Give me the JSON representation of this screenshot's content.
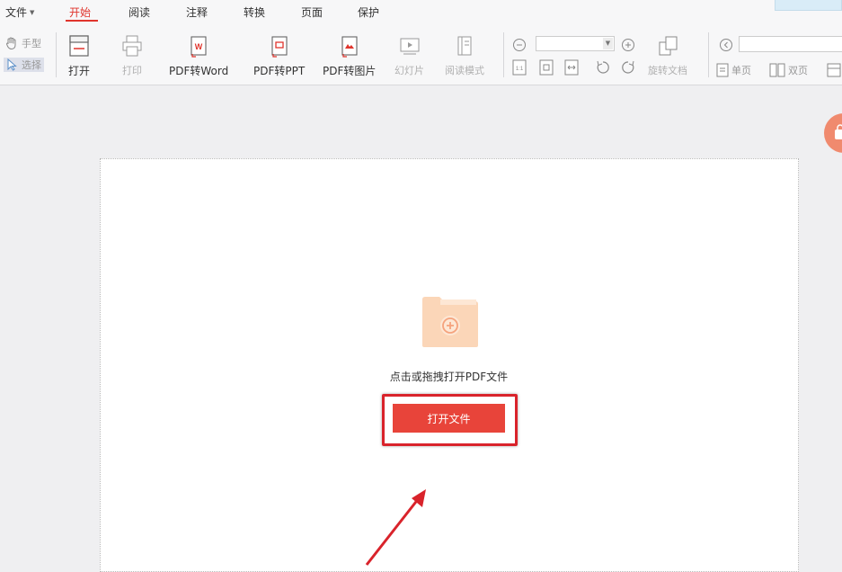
{
  "menu": {
    "file": "文件",
    "tabs": [
      "开始",
      "阅读",
      "注释",
      "转换",
      "页面",
      "保护"
    ],
    "active_tab": "开始"
  },
  "toolbar": {
    "hand_mode": "手型",
    "select_mode": "选择",
    "open": "打开",
    "print": "打印",
    "pdf_to_word": "PDF转Word",
    "pdf_to_ppt": "PDF转PPT",
    "pdf_to_image": "PDF转图片",
    "slideshow": "幻灯片",
    "reading_mode": "阅读模式",
    "rotate_doc": "旋转文档",
    "single_page": "单页",
    "double_page": "双页",
    "zoom_value": "",
    "page_value": ""
  },
  "main": {
    "hint": "点击或拖拽打开PDF文件",
    "open_file_button": "打开文件"
  },
  "colors": {
    "accent": "#e0342c",
    "button_bg": "#e8443a",
    "folder": "#fbd6b8",
    "highlight_box": "#d9232b",
    "arrow": "#d9232b"
  }
}
